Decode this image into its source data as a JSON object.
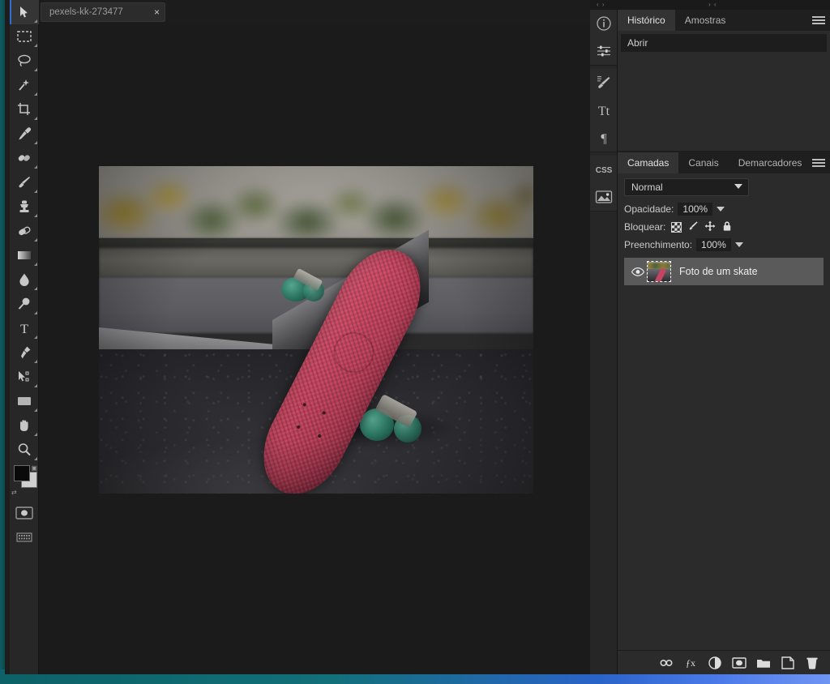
{
  "app": {
    "document_tab": {
      "title": "pexels-kk-273477",
      "close_label": "×"
    }
  },
  "toolbar": {
    "tools": [
      {
        "name": "move-tool",
        "label": "Mover"
      },
      {
        "name": "rectangular-marquee-tool",
        "label": "Letreiro retangular"
      },
      {
        "name": "lasso-tool",
        "label": "Laço"
      },
      {
        "name": "magic-wand-tool",
        "label": "Varinha mágica"
      },
      {
        "name": "crop-tool",
        "label": "Corte demarcado"
      },
      {
        "name": "eyedropper-tool",
        "label": "Conta-gotas"
      },
      {
        "name": "healing-brush-tool",
        "label": "Pincel de recuperação"
      },
      {
        "name": "brush-tool",
        "label": "Pincel"
      },
      {
        "name": "clone-stamp-tool",
        "label": "Carimbo"
      },
      {
        "name": "eraser-tool",
        "label": "Borracha"
      },
      {
        "name": "gradient-tool",
        "label": "Degradê"
      },
      {
        "name": "blur-tool",
        "label": "Desfoque"
      },
      {
        "name": "dodge-tool",
        "label": "Subexposição"
      },
      {
        "name": "type-tool",
        "label": "Texto"
      },
      {
        "name": "pen-tool",
        "label": "Caneta"
      },
      {
        "name": "path-selection-tool",
        "label": "Seleção de demarcador"
      },
      {
        "name": "shape-tool",
        "label": "Retângulo"
      },
      {
        "name": "hand-tool",
        "label": "Mão"
      },
      {
        "name": "zoom-tool",
        "label": "Zoom"
      }
    ],
    "active_tool": "move-tool",
    "swatches": {
      "foreground_color": "#0a0a0a",
      "background_color": "#cfcfcf",
      "reset_label": "reset-colors",
      "default_label": "default-colors"
    },
    "quick_mask_label": "Modo máscara rápida",
    "screen_mode_label": "Modo de tela"
  },
  "rail": {
    "buttons": [
      {
        "name": "info-panel-icon",
        "glyph": "i"
      },
      {
        "name": "adjustments-panel-icon",
        "glyph": "sliders"
      },
      {
        "name": "brushes-panel-icon",
        "glyph": "brush"
      },
      {
        "name": "character-panel-icon",
        "glyph": "Tt"
      },
      {
        "name": "paragraph-panel-icon",
        "glyph": "¶"
      },
      {
        "name": "css-panel-icon",
        "glyph": "CSS"
      },
      {
        "name": "image-panel-icon",
        "glyph": "image"
      }
    ]
  },
  "dock": {
    "collapse_left": "‹ ›",
    "collapse_right": "› ‹"
  },
  "history_panel": {
    "tabs": [
      {
        "label": "Histórico",
        "active": true
      },
      {
        "label": "Amostras",
        "active": false
      }
    ],
    "items": [
      {
        "label": "Abrir"
      }
    ],
    "menu_label": "Menu do painel"
  },
  "layers_panel": {
    "tabs": [
      {
        "label": "Camadas",
        "active": true
      },
      {
        "label": "Canais",
        "active": false
      },
      {
        "label": "Demarcadores",
        "active": false
      }
    ],
    "menu_label": "Menu do painel",
    "blend_mode": "Normal",
    "opacity_label": "Opacidade:",
    "opacity_value": "100%",
    "lock_label": "Bloquear:",
    "lock_icons": [
      {
        "name": "lock-transparent-pixels-icon"
      },
      {
        "name": "lock-image-pixels-icon"
      },
      {
        "name": "lock-position-icon"
      },
      {
        "name": "lock-all-icon"
      }
    ],
    "fill_label": "Preenchimento:",
    "fill_value": "100%",
    "layers": [
      {
        "name": "Foto de um skate",
        "visible": true,
        "selected": true
      }
    ],
    "footer_buttons": [
      {
        "name": "link-layers-icon",
        "label": "Vincular camadas"
      },
      {
        "name": "layer-effects-icon",
        "label": "Efeitos"
      },
      {
        "name": "adjustment-layer-icon",
        "label": "Camada de ajuste"
      },
      {
        "name": "layer-mask-icon",
        "label": "Máscara de camada"
      },
      {
        "name": "new-group-icon",
        "label": "Novo grupo"
      },
      {
        "name": "new-layer-icon",
        "label": "Nova camada"
      },
      {
        "name": "delete-layer-icon",
        "label": "Excluir camada"
      }
    ]
  },
  "canvas": {
    "image_alt": "Foto de um skate rosa apoiado em uma mureta de concreto"
  }
}
